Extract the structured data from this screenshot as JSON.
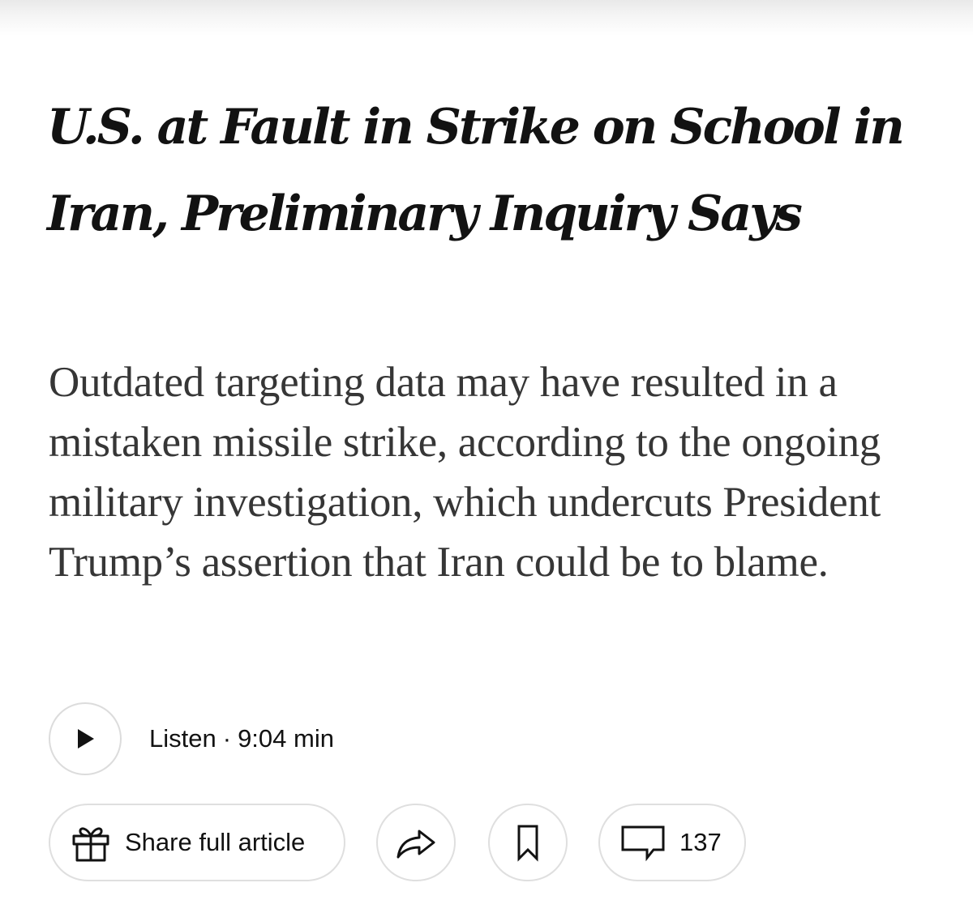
{
  "article": {
    "headline": "U.S. at Fault in Strike on School in Iran, Preliminary Inquiry Says",
    "summary": "Outdated targeting data may have resulted in a mistaken missile strike, according to the ongoing military investigation, which undercuts President Trump’s assertion that Iran could be to blame."
  },
  "audio": {
    "listen_label": "Listen",
    "separator": "·",
    "duration": "9:04 min",
    "play_icon": "play-icon"
  },
  "actions": {
    "share_full_label": "Share full article",
    "share_full_icon": "gift-icon",
    "share_icon": "share-arrow-icon",
    "save_icon": "bookmark-icon",
    "comments_icon": "comment-bubble-icon",
    "comments_count": "137"
  },
  "colors": {
    "text": "#121212",
    "summary_text": "#363636",
    "border": "#dfdfdf"
  }
}
